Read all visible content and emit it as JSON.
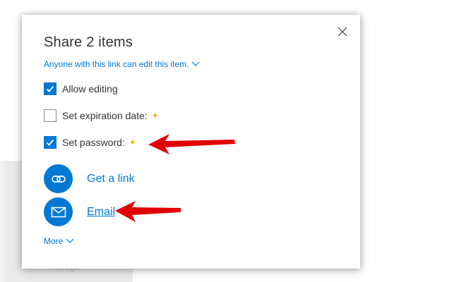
{
  "dialog": {
    "title": "Share 2 items",
    "link_scope": "Anyone with this link can edit this item.",
    "options": [
      {
        "label": "Allow editing",
        "checked": true,
        "premium": false
      },
      {
        "label": "Set expiration date:",
        "checked": false,
        "premium": true
      },
      {
        "label": "Set password:",
        "checked": true,
        "premium": true
      }
    ],
    "actions": [
      {
        "label": "Get a link",
        "icon": "link-icon"
      },
      {
        "label": "Email",
        "icon": "mail-icon"
      }
    ],
    "more_label": "More"
  },
  "background": {
    "partial_text": "…orage"
  },
  "colors": {
    "accent": "#0078d4",
    "annotation_arrow": "#e00000",
    "premium_star": "#f2b600"
  }
}
